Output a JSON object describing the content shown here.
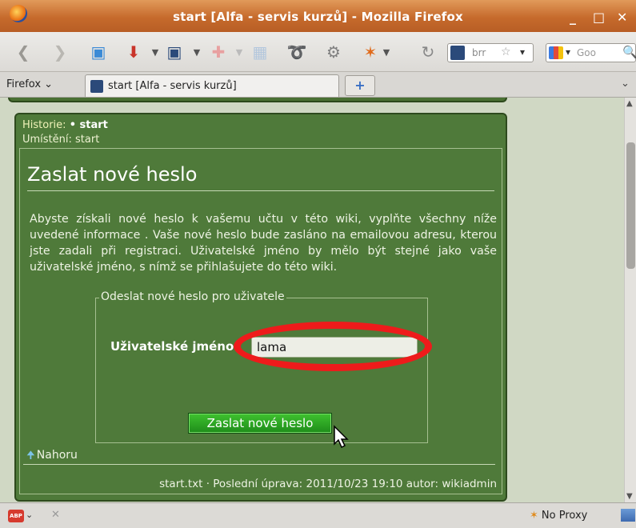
{
  "window": {
    "title": "start [Alfa - servis kurzů] - Mozilla Firefox",
    "minimize": "_",
    "maximize": "□",
    "close": "✕"
  },
  "toolbar": {
    "page_field_text": "brr",
    "search_text": "Goo"
  },
  "tabs": {
    "firefox_menu": "Firefox",
    "active_tab": "start [Alfa - servis kurzů]",
    "new_tab": "+"
  },
  "page": {
    "history_label": "Historie:",
    "history_item": "• start",
    "location": "Umístění: start",
    "heading": "Zaslat nové heslo",
    "intro": "Abyste získali nové heslo k vašemu učtu v této wiki, vyplňte všechny níže uvedené informace . Vaše nové heslo bude zasláno na emailovou adresu, kterou jste zadali při registraci. Uživatelské jméno by mělo být stejné jako vaše uživatelské jméno, s nímž se přihlašujete do této wiki.",
    "form": {
      "legend": "Odeslat nové heslo pro uživatele",
      "username_label": "Uživatelské jméno",
      "username_value": "lama",
      "submit": "Zaslat nové heslo"
    },
    "back_to_top": "Nahoru",
    "footer": "start.txt · Poslední úprava: 2011/10/23 19:10 autor: wikiadmin"
  },
  "statusbar": {
    "adblock": "ABP",
    "proxy": "No Proxy"
  },
  "colors": {
    "panel": "#4f7a3a",
    "annotation_oval": "#ee1b1b",
    "submit_button": "#1e8c1a"
  }
}
